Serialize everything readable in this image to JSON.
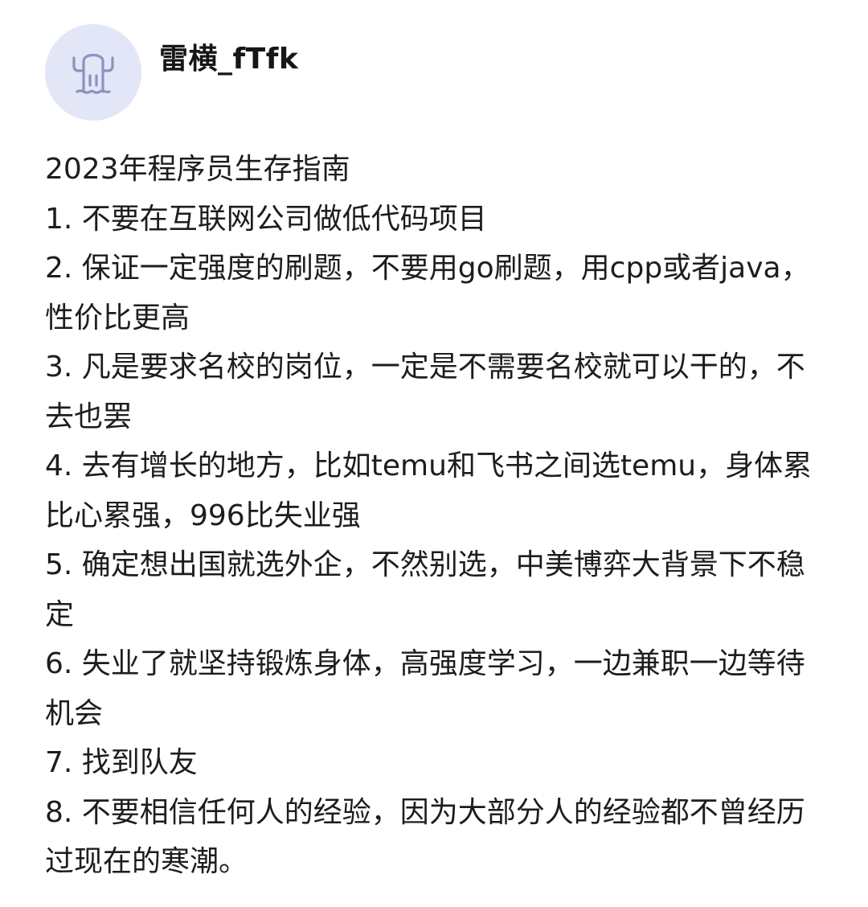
{
  "author": {
    "avatar_icon": "cactus-ghost-icon",
    "avatar_bg": "#e3e6f6",
    "avatar_stroke": "#8a93c0",
    "username": "雷横_fTfk"
  },
  "post": {
    "title": "2023年程序员生存指南",
    "items": [
      "1. 不要在互联网公司做低代码项目",
      "2. 保证一定强度的刷题，不要用go刷题，用cpp或者java，性价比更高",
      "3. 凡是要求名校的岗位，一定是不需要名校就可以干的，不去也罢",
      "4. 去有增长的地方，比如temu和飞书之间选temu，身体累比心累强，996比失业强",
      "5. 确定想出国就选外企，不然别选，中美博弈大背景下不稳定",
      "6. 失业了就坚持锻炼身体，高强度学习，一边兼职一边等待机会",
      "7. 找到队友",
      "8. 不要相信任何人的经验，因为大部分人的经验都不曾经历过现在的寒潮。"
    ]
  }
}
